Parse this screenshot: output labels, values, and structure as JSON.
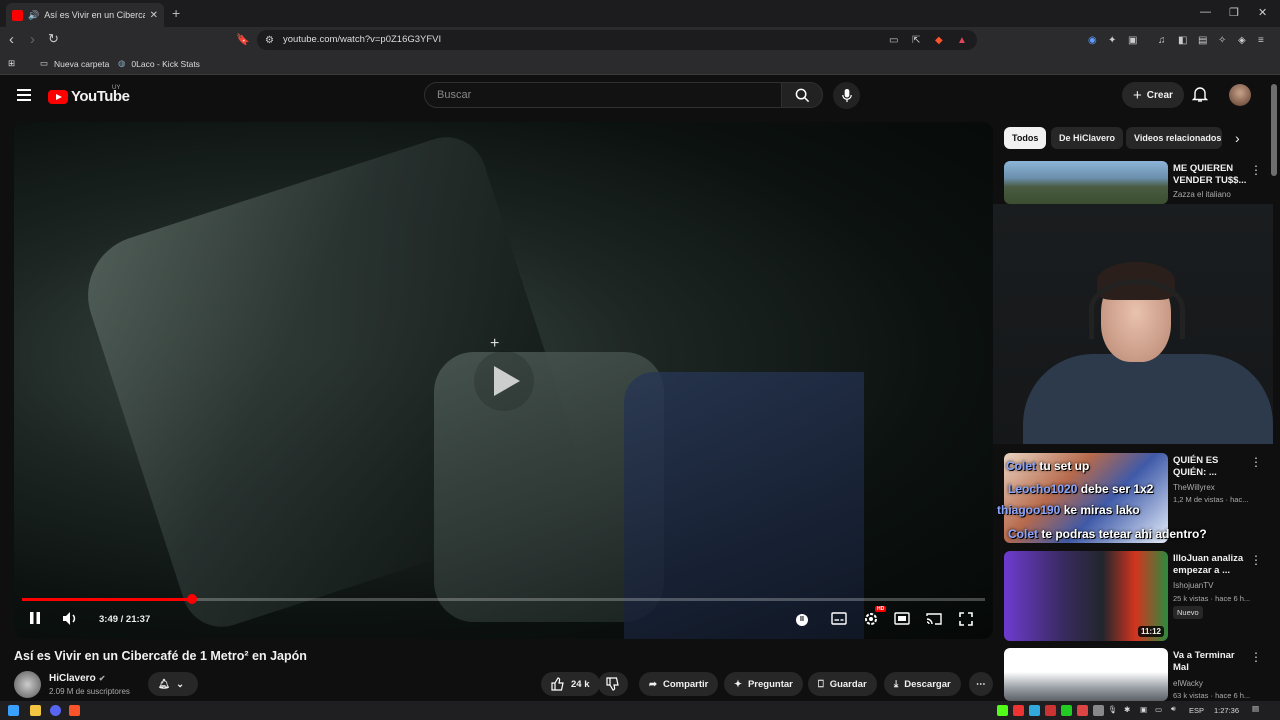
{
  "browser": {
    "tab_title": "Así es Vivir en un Cibercafé de 1 Metro² en Japón - YouTube",
    "url": "youtube.com/watch?v=p0Z16G3YFVI",
    "bookmarks": [
      {
        "label": "Nueva carpeta"
      },
      {
        "label": "0Laco - Kick Stats"
      }
    ]
  },
  "yt": {
    "logo": "YouTube",
    "country": "UY",
    "search_placeholder": "Buscar",
    "create_label": "Crear"
  },
  "video": {
    "current_time": "3:49",
    "duration": "21:37",
    "time_display": "3:49 / 21:37",
    "progress": 0.177,
    "title": "Así es Vivir en un Cibercafé de 1 Metro² en Japón",
    "channel": "HiClavero",
    "subscribers": "2.09 M de suscriptores",
    "likes": "24 k",
    "share_label": "Compartir",
    "ask_label": "Preguntar",
    "save_label": "Guardar",
    "download_label": "Descargar"
  },
  "sidebar": {
    "chips": [
      "Todos",
      "De HiClavero",
      "Videos relacionados"
    ],
    "videos": [
      {
        "title": "ME QUIEREN VENDER TU$$...",
        "channel": "Zazza el italiano",
        "meta": ""
      },
      {
        "title": "QUIÉN ES QUIÉN: ...",
        "channel": "TheWillyrex",
        "meta": "1,2 M de vistas · hac..."
      },
      {
        "title": "IlloJuan analiza empezar a ...",
        "channel": "IshojuanTV",
        "meta": "25 k vistas · hace 6 h...",
        "badge": "Nuevo",
        "duration": "11:12"
      },
      {
        "title": "Va a Terminar Mal",
        "channel": "elWacky",
        "meta": "63 k vistas · hace 6 h..."
      }
    ]
  },
  "chat": [
    {
      "user": "Colet",
      "text": "tu set up"
    },
    {
      "user": "Leocho1020",
      "text": "debe ser 1x2"
    },
    {
      "user": "thiagoo190",
      "text": "ke miras lako"
    },
    {
      "user": "Colet",
      "text": "te podras tetear ahi adentro?"
    }
  ],
  "taskbar": {
    "lang": "ESP",
    "clock": "1:27:36"
  },
  "colors": {
    "accent": "#ff0000",
    "bg": "#0f0f0f",
    "chip": "#272727"
  }
}
